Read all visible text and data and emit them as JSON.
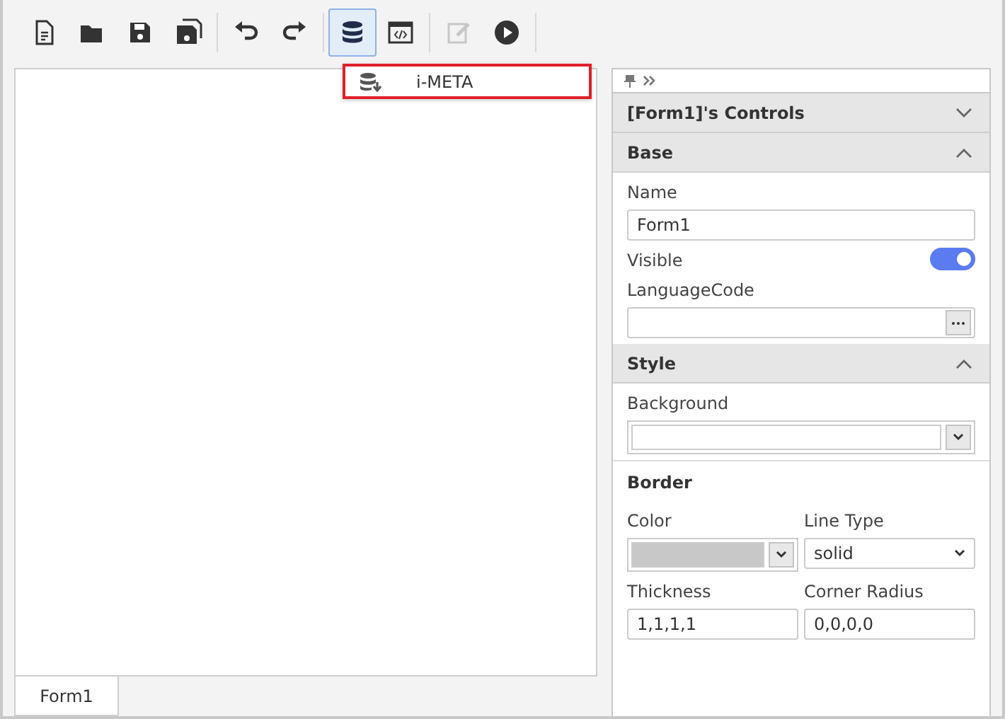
{
  "toolbar": {
    "groups": [
      [
        {
          "selected": false,
          "disabled": false
        },
        {
          "selected": false,
          "disabled": false
        },
        {
          "selected": false,
          "disabled": false
        },
        {
          "selected": false,
          "disabled": false
        }
      ],
      [
        {
          "selected": false,
          "disabled": false
        },
        {
          "selected": false,
          "disabled": false
        }
      ],
      [
        {
          "selected": true,
          "disabled": false
        },
        {
          "selected": false,
          "disabled": false
        }
      ],
      [
        {
          "selected": false,
          "disabled": true
        },
        {
          "selected": false,
          "disabled": false
        }
      ]
    ]
  },
  "dropdown_menu": {
    "items": [
      {
        "label": "i-META",
        "selected": true
      }
    ]
  },
  "canvas_tabs": [
    {
      "label": "Form1",
      "selected": true
    }
  ],
  "panel": {
    "sections": [
      {
        "title": "[Form1]'s Controls",
        "expanded": false
      },
      {
        "title": "Base",
        "expanded": true,
        "rows": [
          [
            {
              "kind": "text",
              "label": "Name",
              "value": "Form1"
            }
          ],
          [
            {
              "kind": "switch",
              "label": "Visible",
              "on": true
            }
          ],
          [
            {
              "kind": "browse",
              "label": "LanguageCode"
            }
          ]
        ]
      },
      {
        "title": "Style",
        "expanded": true,
        "rows": [
          [
            {
              "kind": "color",
              "label": "Background",
              "color": "#ffffff"
            }
          ],
          [
            {
              "kind": "heading",
              "label": "Border"
            }
          ],
          [
            {
              "kind": "color",
              "label": "Color",
              "color": "#c8c8c8"
            },
            {
              "kind": "select",
              "label": "Line Type",
              "value": "solid"
            }
          ],
          [
            {
              "kind": "text",
              "label": "Thickness",
              "value": "1,1,1,1"
            },
            {
              "kind": "text",
              "label": "Corner Radius",
              "value": "0,0,0,0"
            }
          ]
        ]
      }
    ]
  }
}
